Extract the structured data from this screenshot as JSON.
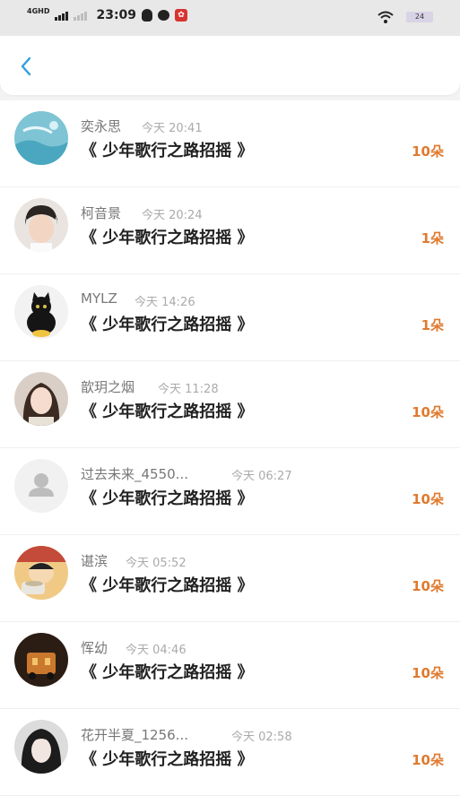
{
  "status_bar": {
    "network": "4GHD",
    "time": "23:09",
    "battery": "24"
  },
  "header": {
    "back_icon": "chevron-left-icon"
  },
  "colors": {
    "accent": "#2f9fe0",
    "count": "#e07a2f"
  },
  "records": [
    {
      "name": "奕永思",
      "time": "今天 20:41",
      "song": "《 少年歌行之路招摇 》",
      "count": "10朵"
    },
    {
      "name": "柯音景",
      "time": "今天 20:24",
      "song": "《 少年歌行之路招摇 》",
      "count": "1朵"
    },
    {
      "name": "MYLZ",
      "time": "今天 14:26",
      "song": "《 少年歌行之路招摇 》",
      "count": "1朵"
    },
    {
      "name": "歆玥之烟",
      "time": "今天 11:28",
      "song": "《 少年歌行之路招摇 》",
      "count": "10朵"
    },
    {
      "name": "过去未来_4550...",
      "time": "今天 06:27",
      "song": "《 少年歌行之路招摇 》",
      "count": "10朵"
    },
    {
      "name": "谌滨",
      "time": "今天 05:52",
      "song": "《 少年歌行之路招摇 》",
      "count": "10朵"
    },
    {
      "name": "恽幼",
      "time": "今天 04:46",
      "song": "《 少年歌行之路招摇 》",
      "count": "10朵"
    },
    {
      "name": "花开半夏_1256...",
      "time": "今天 02:58",
      "song": "《 少年歌行之路招摇 》",
      "count": "10朵"
    }
  ]
}
